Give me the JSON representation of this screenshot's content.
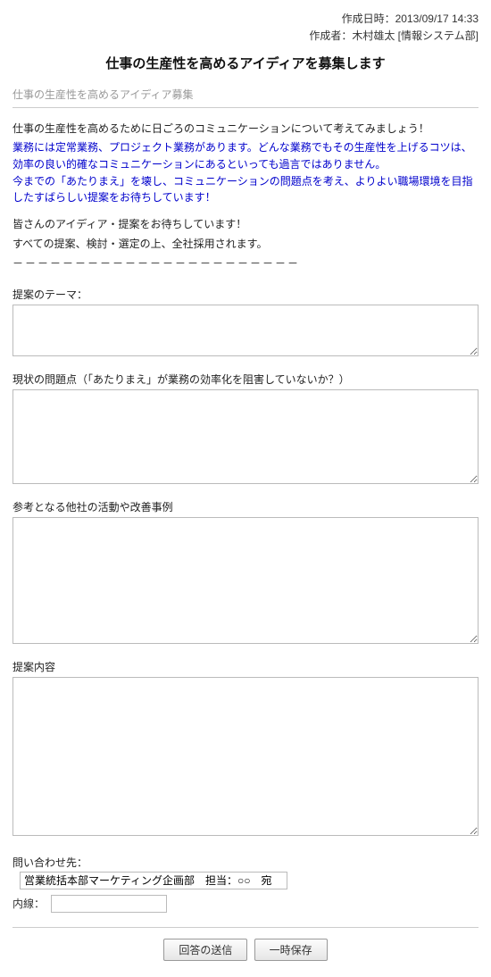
{
  "meta": {
    "created_at_label": "作成日時：",
    "created_at_value": "2013/09/17 14:33",
    "creator_label": "作成者：",
    "creator_value": "木村雄太 [情報システム部]"
  },
  "title": "仕事の生産性を高めるアイディアを募集します",
  "subtitle": "仕事の生産性を高めるアイディア募集",
  "lead": "仕事の生産性を高めるために日ごろのコミュニケーションについて考えてみましょう！",
  "blue1": "業務には定常業務、プロジェクト業務があります。どんな業務でもその生産性を上げるコツは、効率の良い的確なコミュニケーションにあるといっても過言ではありません。",
  "blue2": "今までの「あたりまえ」を壊し、コミュニケーションの問題点を考え、よりよい職場環境を目指したすばらしい提案をお待ちしています！",
  "body1": "皆さんのアイディア・提案をお待ちしています！",
  "body2": "すべての提案、検討・選定の上、全社採用されます。",
  "dashes": "－－－－－－－－－－－－－－－－－－－－－－－",
  "fields": {
    "theme_label": "提案のテーマ：",
    "theme_value": "",
    "problem_label": "現状の問題点（「あたりまえ」が業務の効率化を阻害していないか？）",
    "problem_value": "",
    "reference_label": "参考となる他社の活動や改善事例",
    "reference_value": "",
    "proposal_label": "提案内容",
    "proposal_value": ""
  },
  "contact": {
    "label": "問い合わせ先：",
    "value": "営業統括本部マーケティング企画部　担当：○○　宛"
  },
  "extension": {
    "label": "内線：",
    "value": ""
  },
  "actions": {
    "submit": "回答の送信",
    "save": "一時保存"
  }
}
